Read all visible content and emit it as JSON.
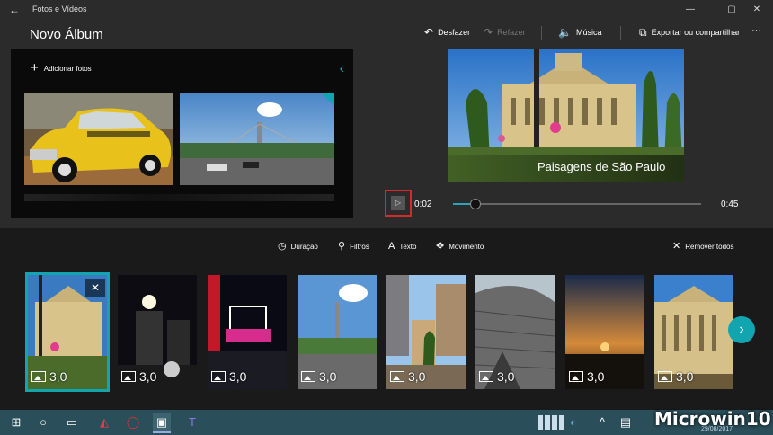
{
  "window": {
    "app_title": "Fotos e Vídeos",
    "minimize": "—",
    "maximize": "▢",
    "close": "✕"
  },
  "header": {
    "album_title": "Novo Álbum",
    "undo_label": "Desfazer",
    "redo_label": "Refazer",
    "music_label": "Música",
    "export_label": "Exportar ou compartilhar",
    "more_label": "···"
  },
  "library": {
    "add_photos_label": "Adicionar fotos",
    "collapse_icon": "chevron-left-icon"
  },
  "preview": {
    "caption": "Paisagens de São Paulo",
    "current_time": "0:02",
    "total_time": "0:45",
    "progress": 0.09
  },
  "tools": {
    "duration_label": "Duração",
    "filters_label": "Filtros",
    "text_label": "Texto",
    "motion_label": "Movimento",
    "remove_all_label": "Remover todos"
  },
  "storyboard": {
    "cards": [
      {
        "duration": "3,0",
        "selected": true
      },
      {
        "duration": "3,0"
      },
      {
        "duration": "3,0"
      },
      {
        "duration": "3,0"
      },
      {
        "duration": "3,0"
      },
      {
        "duration": "3,0"
      },
      {
        "duration": "3,0"
      },
      {
        "duration": "3,0"
      }
    ]
  },
  "taskbar": {
    "date": "29/08/2017"
  },
  "watermark": "Microwin10",
  "colors": {
    "accent": "#11a5b0",
    "highlight_box": "#d12b2b",
    "background": "#1f1f1f"
  }
}
